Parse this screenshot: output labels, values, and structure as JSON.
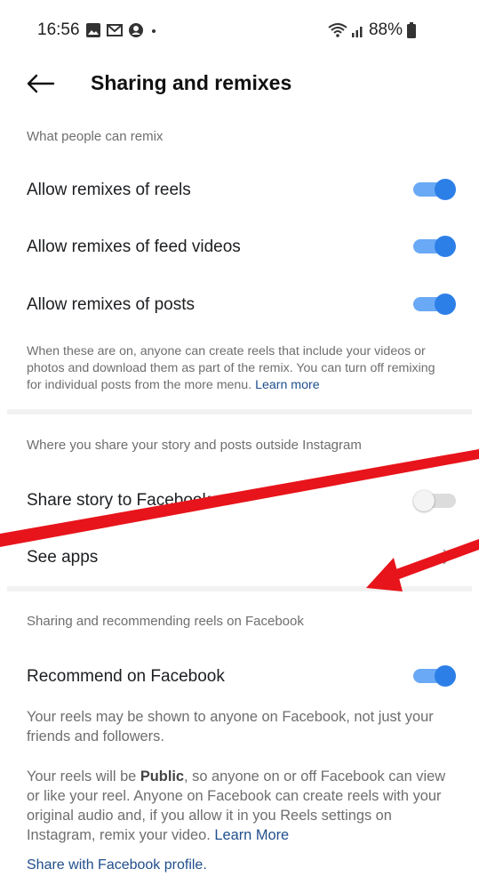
{
  "status_bar": {
    "time": "16:56",
    "battery": "88%",
    "icons": [
      "gallery-icon",
      "gmail-icon",
      "account-icon",
      "dot-icon",
      "wifi-icon",
      "signal-icon",
      "battery-icon"
    ]
  },
  "header": {
    "title": "Sharing and remixes",
    "back_icon": "back-arrow-icon"
  },
  "remix": {
    "section_label": "What people can remix",
    "items": [
      {
        "label": "Allow remixes of reels",
        "on": true
      },
      {
        "label": "Allow remixes of feed videos",
        "on": true
      },
      {
        "label": "Allow remixes of posts",
        "on": true
      }
    ],
    "description": "When these are on, anyone can create reels that include your videos or photos and download them as part of the remix. You can turn off remixing for individual posts from the more menu.",
    "learn_more": "Learn more"
  },
  "outside": {
    "section_label": "Where you share your story and posts outside Instagram",
    "share_story_label": "Share story to Facebook",
    "share_story_on": false,
    "see_apps_label": "See apps"
  },
  "facebook": {
    "section_label": "Sharing and recommending reels on Facebook",
    "recommend_label": "Recommend on Facebook",
    "recommend_on": true,
    "desc1": "Your reels may be shown to anyone on Facebook, not just your friends and followers.",
    "desc2_before": "Your reels will be ",
    "desc2_bold": "Public",
    "desc2_after": ", so anyone on or off Facebook can view or like your reel. Anyone on Facebook can create reels with your original audio and, if you allow it in you Reels settings on Instagram, remix your video. ",
    "learn_more": "Learn More",
    "profile_link": "Share with Facebook profile."
  },
  "colors": {
    "toggle_on_track": "#6aa9f5",
    "toggle_on_knob": "#2d7fe8",
    "annotation_red": "#e8141b",
    "link": "#1f4e8c"
  }
}
